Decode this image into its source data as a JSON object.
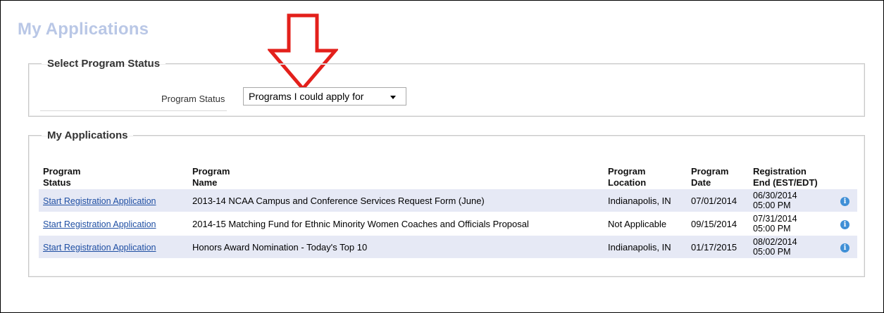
{
  "page": {
    "title": "My Applications"
  },
  "status_section": {
    "legend": "Select Program Status",
    "label": "Program Status",
    "selected": "Programs I could apply for"
  },
  "applications_section": {
    "legend": "My Applications",
    "columns": [
      {
        "line1": "Program",
        "line2": "Status"
      },
      {
        "line1": "Program",
        "line2": "Name"
      },
      {
        "line1": "Program",
        "line2": "Location"
      },
      {
        "line1": "Program",
        "line2": "Date"
      },
      {
        "line1": "Registration",
        "line2": "End (EST/EDT)"
      }
    ],
    "rows": [
      {
        "action": "Start Registration Application",
        "name": "2013-14 NCAA Campus and Conference Services Request Form (June)",
        "location": "Indianapolis, IN",
        "date": "07/01/2014",
        "end_date": "06/30/2014",
        "end_time": "05:00 PM",
        "info": "i"
      },
      {
        "action": "Start Registration Application",
        "name": "2014-15 Matching Fund for Ethnic Minority Women Coaches and Officials Proposal",
        "location": "Not Applicable",
        "date": "09/15/2014",
        "end_date": "07/31/2014",
        "end_time": "05:00 PM",
        "info": "i"
      },
      {
        "action": "Start Registration Application",
        "name": "Honors Award Nomination - Today's Top 10",
        "location": "Indianapolis, IN",
        "date": "01/17/2015",
        "end_date": "08/02/2014",
        "end_time": "05:00 PM",
        "info": "i"
      }
    ]
  },
  "annotation": {
    "icon": "down-arrow-icon",
    "color": "#e3201b"
  },
  "colors": {
    "title": "#b9c7e6",
    "row_alt": "#e6e9f5",
    "link": "#1f4fa3",
    "info": "#3f8fd6"
  }
}
